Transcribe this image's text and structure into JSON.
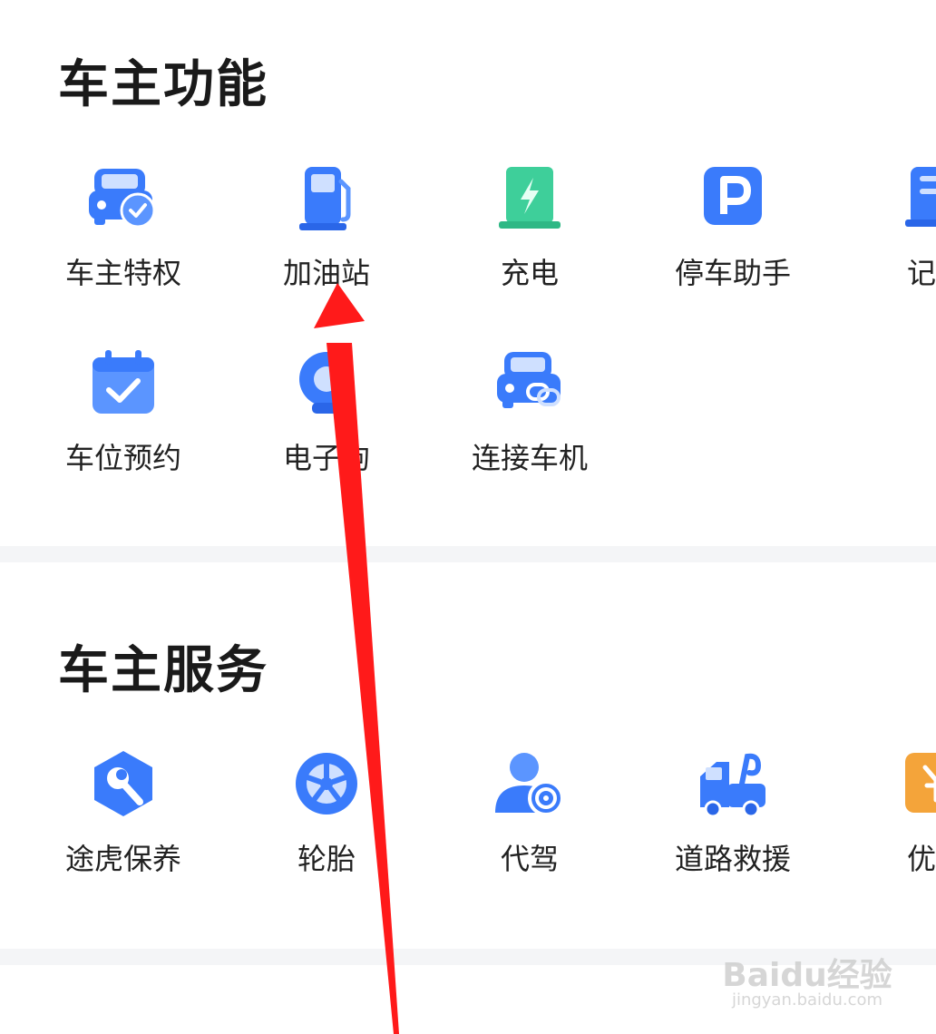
{
  "section_features": {
    "title": "车主功能",
    "items": [
      {
        "label": "车主特权",
        "icon": "car-check-icon"
      },
      {
        "label": "加油站",
        "icon": "fuel-pump-icon"
      },
      {
        "label": "充电",
        "icon": "charging-icon"
      },
      {
        "label": "停车助手",
        "icon": "parking-icon"
      },
      {
        "label": "记录",
        "icon": "record-icon"
      },
      {
        "label": "车位预约",
        "icon": "calendar-check-icon"
      },
      {
        "label": "电子狗",
        "icon": "radar-icon"
      },
      {
        "label": "连接车机",
        "icon": "car-link-icon"
      }
    ]
  },
  "section_services": {
    "title": "车主服务",
    "items": [
      {
        "label": "途虎保养",
        "icon": "wrench-icon"
      },
      {
        "label": "轮胎",
        "icon": "tire-icon"
      },
      {
        "label": "代驾",
        "icon": "driver-icon"
      },
      {
        "label": "道路救援",
        "icon": "tow-truck-icon"
      },
      {
        "label": "优惠",
        "icon": "coupon-icon"
      }
    ]
  },
  "watermark": {
    "brand": "Baidu经验",
    "url": "jingyan.baidu.com"
  },
  "colors": {
    "primary_blue": "#3a7bfb",
    "green": "#3ecf9a",
    "orange": "#f4a43a"
  }
}
